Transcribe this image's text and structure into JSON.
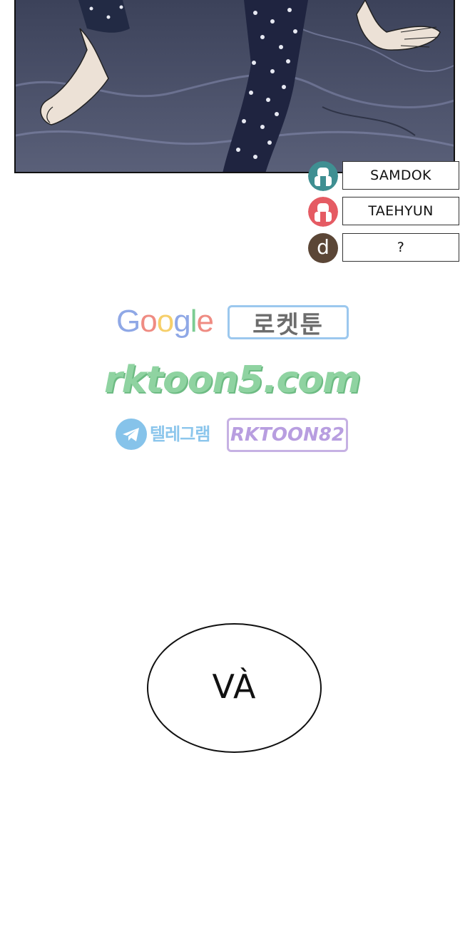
{
  "characters": [
    {
      "avatar": "person-teal-icon",
      "name": "SAMDOK",
      "color": "#3f8f92"
    },
    {
      "avatar": "person-red-icon",
      "name": "TAEHYUN",
      "color": "#e55b63"
    },
    {
      "avatar_letter": "d",
      "name": "?",
      "color": "#5b4636"
    }
  ],
  "watermark": {
    "google": "Google",
    "korean_badge": "로켓툰",
    "site": "rktoon5.com",
    "telegram_label": "텔레그램",
    "telegram_handle": "RKTOON82",
    "colors": {
      "green": "#8fd3a1",
      "blue_border": "#9cc8ee",
      "purple": "#b89ee0"
    }
  },
  "dialogue": {
    "bubble_text": "VÀ"
  }
}
